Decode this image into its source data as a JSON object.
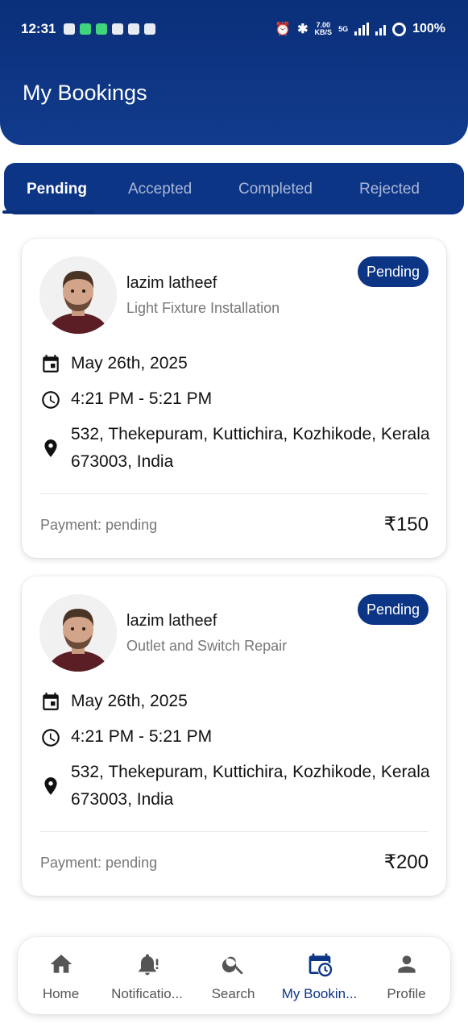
{
  "status_bar": {
    "time": "12:31",
    "speed_value": "7.00",
    "speed_unit": "KB/S",
    "network": "5G",
    "battery": "100%"
  },
  "header": {
    "title": "My Bookings"
  },
  "tabs": [
    {
      "label": "Pending",
      "active": true
    },
    {
      "label": "Accepted",
      "active": false
    },
    {
      "label": "Completed",
      "active": false
    },
    {
      "label": "Rejected",
      "active": false
    }
  ],
  "bookings": [
    {
      "name": "lazim latheef",
      "service": "Light Fixture Installation",
      "status": "Pending",
      "date": "May 26th, 2025",
      "time": "4:21 PM - 5:21 PM",
      "address_line1": "532, Thekepuram, Kuttichira, Kozhikode, Kerala",
      "address_line2": "673003, India",
      "payment": "Payment: pending",
      "price": "₹150"
    },
    {
      "name": "lazim latheef",
      "service": "Outlet and Switch Repair",
      "status": "Pending",
      "date": "May 26th, 2025",
      "time": "4:21 PM - 5:21 PM",
      "address_line1": "532, Thekepuram, Kuttichira, Kozhikode, Kerala",
      "address_line2": "673003, India",
      "payment": "Payment: pending",
      "price": "₹200"
    }
  ],
  "bottom_nav": [
    {
      "label": "Home",
      "icon": "home-icon",
      "active": false
    },
    {
      "label": "Notificatio...",
      "icon": "bell-icon",
      "active": false
    },
    {
      "label": "Search",
      "icon": "search-icon",
      "active": false
    },
    {
      "label": "My Bookin...",
      "icon": "calendar-clock-icon",
      "active": true
    },
    {
      "label": "Profile",
      "icon": "person-icon",
      "active": false
    }
  ],
  "colors": {
    "primary": "#0d3585",
    "header_gradient_top": "#0a2f7a",
    "muted_text": "#777777"
  }
}
